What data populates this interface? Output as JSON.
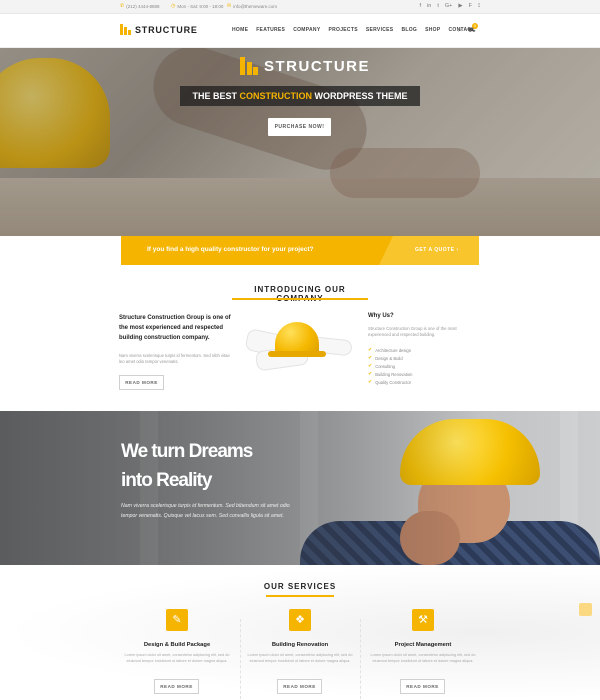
{
  "topbar": {
    "phone": "(212) 4444-8888",
    "hours": "Mon - Sat: 9:00 - 18:00",
    "email": "info@themeware.com",
    "social_icons": [
      "facebook-icon",
      "linkedin-icon",
      "twitter-icon",
      "google-plus-icon",
      "youtube-icon",
      "foursquare-icon",
      "rss-icon"
    ],
    "social_glyphs": [
      "f",
      "in",
      "t",
      "G+",
      "▶",
      "F",
      "⟟"
    ]
  },
  "header": {
    "logo_text": "STRUCTURE",
    "nav": [
      "HOME",
      "FEATURES",
      "COMPANY",
      "PROJECTS",
      "SERVICES",
      "BLOG",
      "SHOP",
      "CONTACT"
    ],
    "cart_count": "0"
  },
  "hero": {
    "logo_text": "STRUCTURE",
    "tagline_pre": "THE BEST ",
    "tagline_highlight": "CONSTRUCTION",
    "tagline_post": " WORDPRESS THEME",
    "button": "PURCHASE NOW!"
  },
  "quote_bar": {
    "text": "If you find a high quality constructor for your project?",
    "button": "GET A QUOTE  ›"
  },
  "intro": {
    "title": "INTRODUCING OUR COMPANY",
    "lead": "Structure Construction Group is one of the most experienced and respected building construction company.",
    "desc": "Nam viverra scelerisque turpis id fermentum. Sed nibh vitae leo amet odio tempor venenatis.",
    "button": "READ MORE",
    "why_title": "Why Us?",
    "why_desc": "Structure Construction Group is one of the most experienced and respected building.",
    "why_items": [
      "Architecture design",
      "Design & Build",
      "Consulting",
      "Building Renovation",
      "Quality Constructor"
    ]
  },
  "dreams": {
    "line1": "We turn Dreams",
    "line2": "into Reality",
    "text": "Nam viverra scelerisque turpis id fermentum. Sed bibendum sit amet odio tempor venenatis. Quisque vel lacus sem. Sed convallis ligula sit amet."
  },
  "services": {
    "title": "OUR SERVICES",
    "items": [
      {
        "name": "Design  & Build Package",
        "desc": "Lorem ipsum dolor sit amet, consectetur adipiscing elit, sed do eiusmod tempor incididunt ut labore et dolore magna aliqua.",
        "button": "READ MORE",
        "icon": "brush-icon",
        "glyph": "✎"
      },
      {
        "name": "Building Renovation",
        "desc": "Lorem ipsum dolor sit amet, consectetur adipiscing elit, sed do eiusmod tempor incididunt ut labore et dolore magna aliqua.",
        "button": "READ MORE",
        "icon": "bricks-icon",
        "glyph": "❖"
      },
      {
        "name": "Project Management",
        "desc": "Lorem ipsum dolor sit amet, consectetur adipiscing elit, sed do eiusmod tempor incididunt ut labore et dolore magna aliqua.",
        "button": "READ MORE",
        "icon": "wrench-icon",
        "glyph": "⚒"
      }
    ]
  },
  "colors": {
    "accent": "#f5b400",
    "dark": "#222222",
    "muted": "#999999"
  }
}
